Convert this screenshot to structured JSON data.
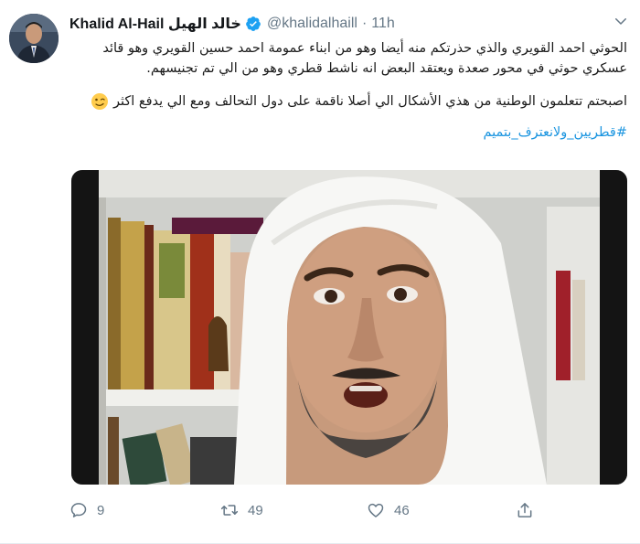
{
  "tweet": {
    "author_name": "Khalid Al-Hail خالد الهيل",
    "handle": "@khalidalhaill",
    "separator": "·",
    "time": "11h",
    "paragraph_1": "الحوثي احمد القويري والذي حذرتكم منه أيضا وهو من ابناء عمومة احمد حسين القويري وهو قائد عسكري حوثي في محور صعدة ويعتقد البعض انه ناشط قطري وهو من الي تم تجنيسهم.",
    "paragraph_2": "اصبحتم تتعلمون الوطنية من هذي الأشكال الي أصلا ناقمة على دول التحالف ومع الي يدفع اكثر",
    "hashtag": "#قطريين_ولانعترف_بتميم"
  },
  "actions": {
    "replies": "9",
    "retweets": "49",
    "likes": "46"
  },
  "colors": {
    "link": "#1b95e0",
    "verified": "#1da1f2",
    "muted": "#657786"
  },
  "icons": [
    "verified-badge-icon",
    "chevron-down-icon",
    "reply-icon",
    "retweet-icon",
    "like-icon",
    "share-icon",
    "winking-face-emoji"
  ]
}
